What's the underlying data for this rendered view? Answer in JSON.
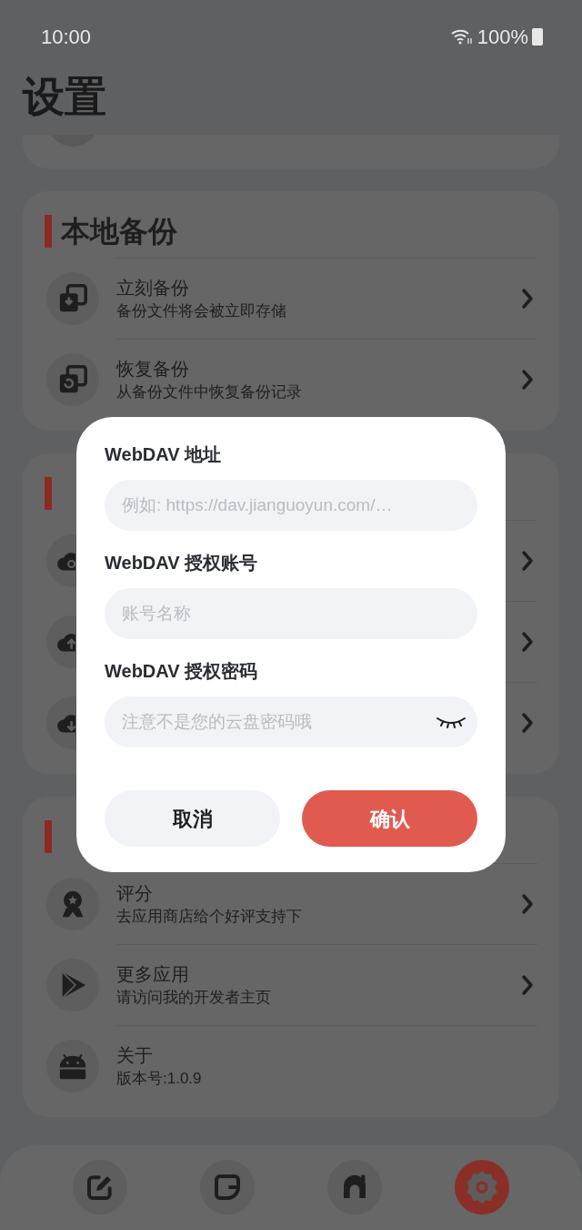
{
  "status_bar": {
    "time": "10:00",
    "battery": "100%"
  },
  "title": "设置",
  "sections": [
    {
      "title": "本地备份",
      "items": [
        {
          "title": "立刻备份",
          "subtitle": "备份文件将会被立即存储",
          "arrow": true
        },
        {
          "title": "恢复备份",
          "subtitle": "从备份文件中恢复备份记录",
          "arrow": true
        }
      ]
    },
    {
      "items": [
        {
          "arrow": true
        },
        {
          "arrow": true
        },
        {
          "arrow": true
        }
      ]
    },
    {
      "items": [
        {
          "title": "评分",
          "subtitle": "去应用商店给个好评支持下",
          "arrow": true
        },
        {
          "title": "更多应用",
          "subtitle": "请访问我的开发者主页",
          "arrow": true
        },
        {
          "title": "关于",
          "subtitle": "版本号:1.0.9",
          "arrow": false
        }
      ]
    }
  ],
  "dialog": {
    "fields": [
      {
        "label": "WebDAV 地址",
        "placeholder": "例如: https://dav.jianguoyun.com/…",
        "kind": "text"
      },
      {
        "label": "WebDAV 授权账号",
        "placeholder": "账号名称",
        "kind": "text"
      },
      {
        "label": "WebDAV 授权密码",
        "placeholder": "注意不是您的云盘密码哦",
        "kind": "password"
      }
    ],
    "buttons": [
      {
        "label": "取消",
        "kind": "cancel"
      },
      {
        "label": "确认",
        "kind": "confirm"
      }
    ]
  },
  "nav": [
    {
      "selected": false
    },
    {
      "selected": false
    },
    {
      "selected": false
    },
    {
      "selected": true
    }
  ]
}
